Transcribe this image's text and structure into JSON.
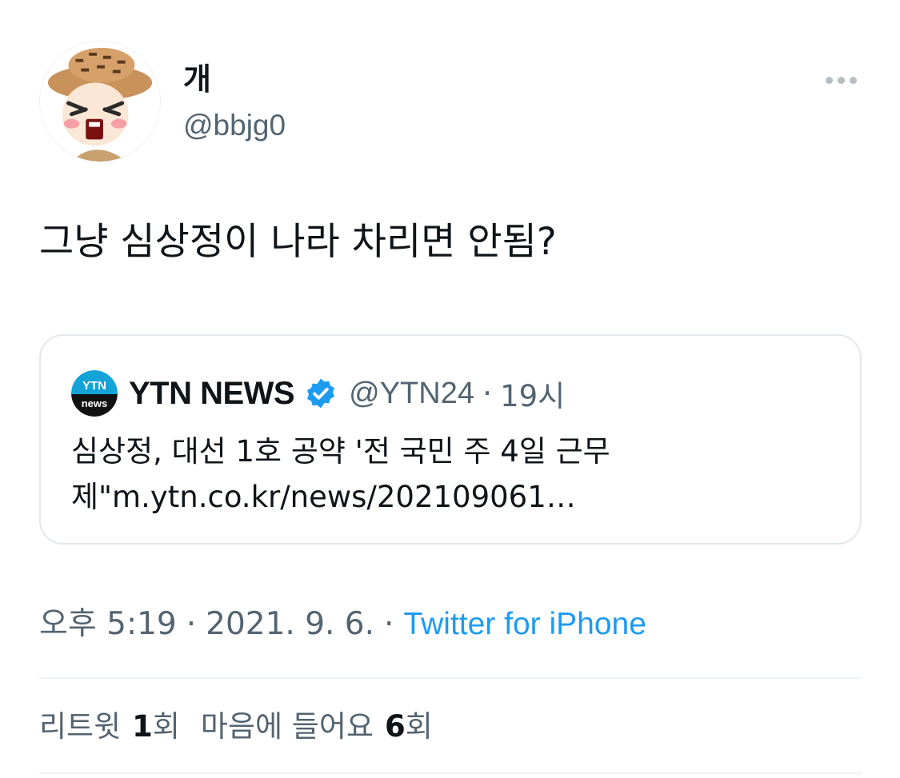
{
  "author": {
    "display_name": "개",
    "handle": "@bbjg0",
    "avatar_icon": "cartoon-avatar-icon"
  },
  "tweet": {
    "text": "그냥 심상정이 나라 차리면 안됨?"
  },
  "quoted_tweet": {
    "name": "YTN NEWS",
    "logo_text_top": "YTN",
    "logo_text_bottom": "news",
    "handle": "@YTN24",
    "separator": "·",
    "time": "19시",
    "text_line_1": "심상정, 대선 1호 공약 '전 국민 주 4일 근무",
    "text_line_2": "제\"m.ytn.co.kr/news/202109061…",
    "verified_icon": "verified-badge-icon"
  },
  "meta": {
    "time": "오후 5:19",
    "separator": "·",
    "date": "2021. 9. 6.",
    "source": "Twitter for iPhone"
  },
  "stats": {
    "retweets_label": "리트윗",
    "retweets_count": "1",
    "retweets_unit": "회",
    "likes_label": "마음에 들어요",
    "likes_count": "6",
    "likes_unit": "회"
  },
  "colors": {
    "link": "#1d9bf0",
    "secondary_text": "#536471",
    "primary_text": "#0f1419",
    "border": "#e3e8ec",
    "verified": "#1d9bf0"
  }
}
